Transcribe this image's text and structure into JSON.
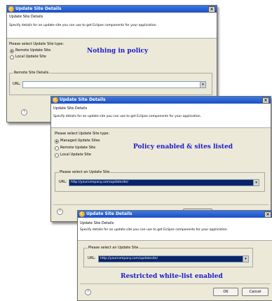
{
  "dialog1": {
    "title": "Update Site Details",
    "header_title": "Update Site Details",
    "header_desc": "Specify details for an update site you can use to get Eclipse components for your application.",
    "type_prompt": "Please select Update Site type:",
    "options": [
      "Remote Update Site",
      "Local Update Site"
    ],
    "selected_option": "Remote Update Site",
    "group_label": "Remote Site Details",
    "url_label": "URL:",
    "url_value": "",
    "caption": "Nothing in policy"
  },
  "dialog2": {
    "title": "Update Site Details",
    "header_title": "Update Site Details",
    "header_desc": "Specify details for an update site you can use to get Eclipse components for your application.",
    "type_prompt": "Please select Update Site type:",
    "options": [
      "Managed Update Sites",
      "Remote Update Site",
      "Local Update Site"
    ],
    "selected_option": "Managed Update Sites",
    "group_label": "Please select an Update Site",
    "url_label": "URL:",
    "url_value": "http://yourcompany.com/updatesite/",
    "caption": "Policy enabled & sites listed"
  },
  "dialog3": {
    "title": "Update Site Details",
    "header_title": "Update Site Details",
    "header_desc": "Specify details for an update site you can use to get Eclipse components for your application.",
    "group_label": "Please select an Update Site",
    "url_label": "URL:",
    "url_value": "http://yourcompany.com/updatesite/",
    "caption": "Restricted white-list enabled",
    "ok_label": "OK",
    "cancel_label": "Cancel"
  },
  "colors": {
    "caption": "#1c1ccc",
    "titlebar": "#1a4fc4",
    "selection": "#0a246a"
  }
}
